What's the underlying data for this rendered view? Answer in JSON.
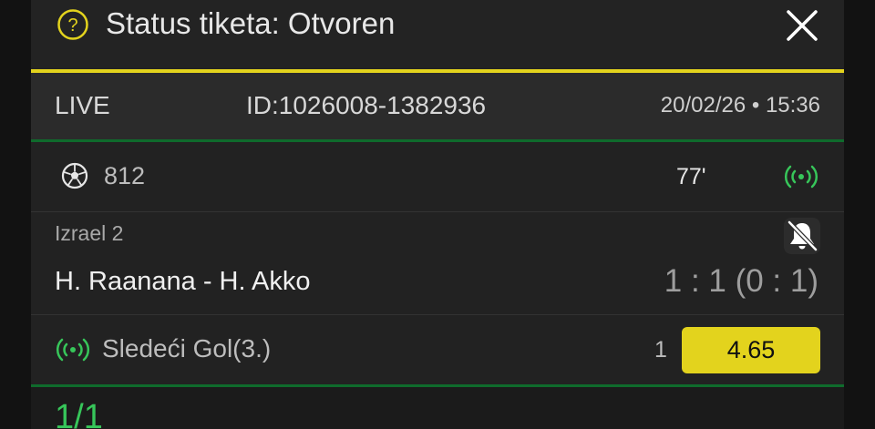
{
  "header": {
    "title": "Status tiketa: Otvoren",
    "help_icon": "question-circle-icon",
    "close_icon": "close-icon"
  },
  "ticket": {
    "type": "LIVE",
    "id": "ID:1026008-1382936",
    "datetime": "20/02/26 • 15:36"
  },
  "event": {
    "sport_icon": "soccer-ball-icon",
    "number": "812",
    "minute": "77'",
    "live_icon": "live-broadcast-icon"
  },
  "match": {
    "league": "Izrael 2",
    "name": "H. Raanana - H. Akko",
    "score": "1 : 1 (0 : 1)",
    "notification_icon": "bell-off-icon"
  },
  "bet": {
    "market": "Sledeći Gol(3.)",
    "pick": "1",
    "odds": "4.65"
  },
  "footer": {
    "count": "1/1"
  },
  "colors": {
    "accent_yellow": "#e3d31d",
    "live_green": "#37c65a",
    "divider_green": "#0f6b2c"
  }
}
